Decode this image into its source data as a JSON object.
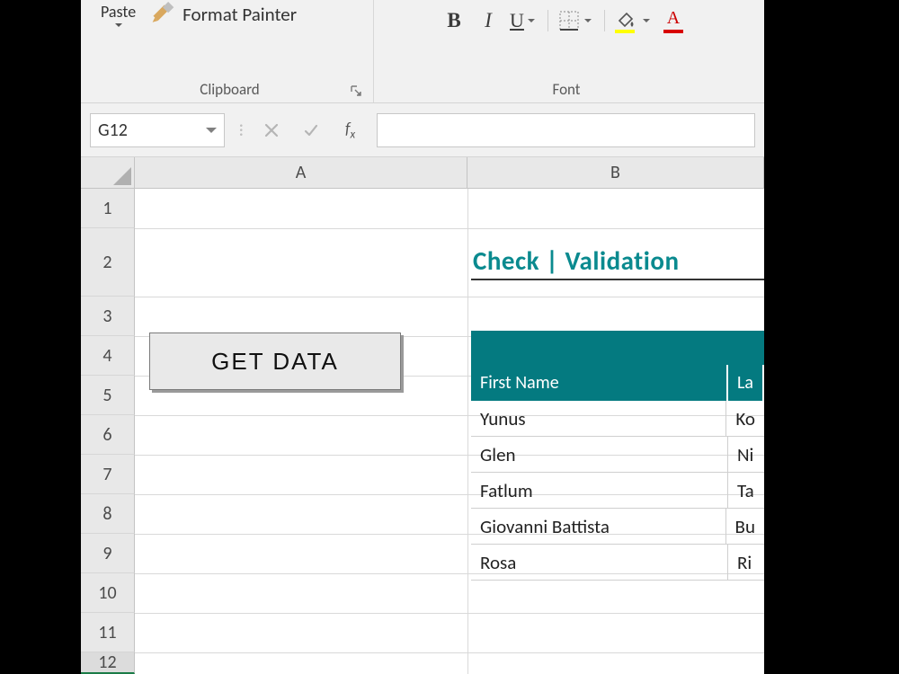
{
  "ribbon": {
    "paste_label": "Paste",
    "format_painter_label": "Format Painter",
    "clipboard_group": "Clipboard",
    "font_group": "Font",
    "bold": "B",
    "italic": "I",
    "underline": "U",
    "font_color_letter": "A"
  },
  "formula_bar": {
    "name_box": "G12",
    "fx_label": "fx"
  },
  "grid": {
    "columns": [
      "A",
      "B"
    ],
    "rows": [
      "1",
      "2",
      "3",
      "4",
      "5",
      "6",
      "7",
      "8",
      "9",
      "10",
      "11",
      "12"
    ]
  },
  "sheet": {
    "title": "Check | Validation",
    "button_label": "GET DATA",
    "table": {
      "headers": [
        "First Name",
        "La"
      ],
      "rows": [
        {
          "first": "Yunus",
          "last": "Ko"
        },
        {
          "first": "Glen",
          "last": "Ni"
        },
        {
          "first": "Fatlum",
          "last": "Ta"
        },
        {
          "first": "Giovanni Battista",
          "last": "Bu"
        },
        {
          "first": "Rosa",
          "last": "Ri"
        }
      ]
    }
  }
}
